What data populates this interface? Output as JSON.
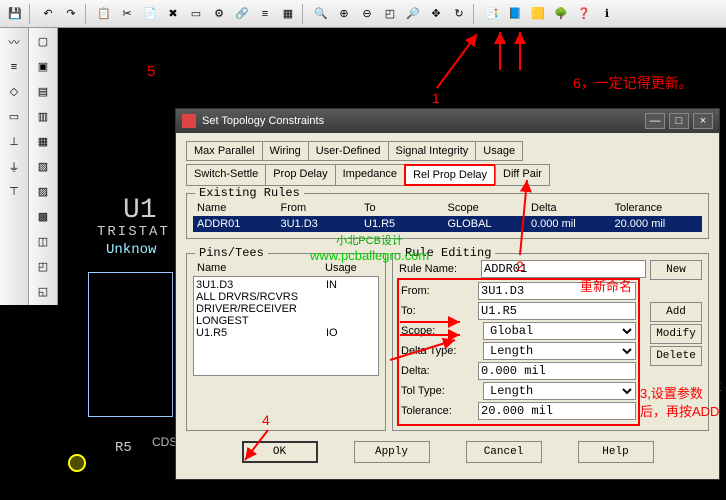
{
  "toolbar_top": [
    "save",
    "undo",
    "redo",
    "copy",
    "cut",
    "paste",
    "delete",
    "sheet",
    "props",
    "net",
    "layer",
    "stack",
    "zoom-fit",
    "zoom-in",
    "zoom-out",
    "zoom-win",
    "zoom",
    "pan",
    "refresh",
    "copy2",
    "template",
    "highlight",
    "layers",
    "help",
    "info"
  ],
  "toolbar_left1": [
    "wire",
    "bus",
    "sym",
    "res",
    "cap",
    "gnd",
    "vcc"
  ],
  "toolbar_left2": [
    "a",
    "b",
    "c",
    "d",
    "e",
    "f",
    "g",
    "h",
    "i",
    "j",
    "k"
  ],
  "dialog": {
    "title": "Set Topology Constraints",
    "tabs_row1": [
      "Max Parallel",
      "Wiring",
      "User-Defined",
      "Signal Integrity",
      "Usage"
    ],
    "tabs_row2": [
      "Switch-Settle",
      "Prop Delay",
      "Impedance",
      "Rel Prop Delay",
      "Diff Pair"
    ],
    "existing": {
      "legend": "Existing Rules",
      "headers": [
        "Name",
        "From",
        "To",
        "Scope",
        "Delta",
        "Tolerance"
      ],
      "row": [
        "ADDR01",
        "3U1.D3",
        "U1.R5",
        "GLOBAL",
        "0.000 mil",
        "20.000 mil"
      ]
    },
    "pins": {
      "legend": "Pins/Tees",
      "headers": [
        "Name",
        "Usage"
      ],
      "rows": [
        {
          "name": "3U1.D3",
          "usage": "IN"
        },
        {
          "name": "ALL DRVRS/RCVRS",
          "usage": ""
        },
        {
          "name": "DRIVER/RECEIVER",
          "usage": ""
        },
        {
          "name": "LONGEST",
          "usage": ""
        },
        {
          "name": "U1.R5",
          "usage": "IO"
        }
      ]
    },
    "edit": {
      "legend": "Rule Editing",
      "rule_name_lbl": "Rule Name:",
      "rule_name": "ADDR01",
      "from_lbl": "From:",
      "from": "3U1.D3",
      "to_lbl": "To:",
      "to": "U1.R5",
      "scope_lbl": "Scope:",
      "scope": "Global",
      "delta_type_lbl": "Delta Type:",
      "delta_type": "Length",
      "delta_lbl": "Delta:",
      "delta": "0.000 mil",
      "tol_type_lbl": "Tol Type:",
      "tol_type": "Length",
      "tolerance_lbl": "Tolerance:",
      "tolerance": "20.000 mil",
      "btn_new": "New",
      "btn_add": "Add",
      "btn_modify": "Modify",
      "btn_delete": "Delete"
    },
    "footer": {
      "ok": "OK",
      "apply": "Apply",
      "cancel": "Cancel",
      "help": "Help"
    }
  },
  "schematic": {
    "u1": "U1",
    "tristat": "TRISTAT",
    "unknown": "Unknow",
    "r5": "R5",
    "cds": "CDSDe",
    "num3": "3",
    "tris": "TRIS",
    "unk": "Unk"
  },
  "watermark": {
    "line1": "小北PCB设计",
    "line2": "www.pcballegro.com"
  },
  "annotations": {
    "n1": "1",
    "n2": "2",
    "n4": "4",
    "n5": "5",
    "n6": "6，一定记得更新。",
    "rename": "重新命名",
    "n3": "3,设置参数后，再按ADD"
  }
}
